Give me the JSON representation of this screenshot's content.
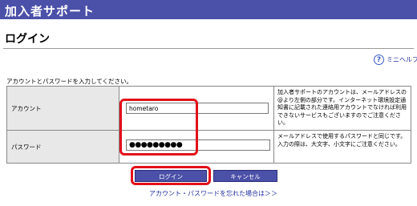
{
  "header": {
    "title": "加入者サポート"
  },
  "page": {
    "title": "ログイン"
  },
  "help": {
    "icon": "question-mark-icon",
    "label": "ミニヘルプ"
  },
  "form": {
    "instruction": "アカウントとパスワードを入力してください。",
    "account": {
      "label": "アカウント",
      "value": "hometaro",
      "note": "加入者サポートのアカウントは、メールアドレスの@より左側の部分です。インターネット環境設定通知書に記載された連絡用アカウントでなければ利用できないサービスもございますのでご注意ください。"
    },
    "password": {
      "label": "パスワード",
      "value": "●●●●●●●●●",
      "note": "メールアドレスで使用するパスワードと同じです。入力の際は、大文字、小文字にご注意ください。"
    }
  },
  "buttons": {
    "login": "ログイン",
    "cancel": "キャンセル"
  },
  "links": {
    "forgot": "アカウント・パスワードを忘れた場合は＞＞"
  },
  "colors": {
    "brand": "#4b50a8",
    "highlight": "#e2101a",
    "label_bg": "#e8e8e8"
  }
}
